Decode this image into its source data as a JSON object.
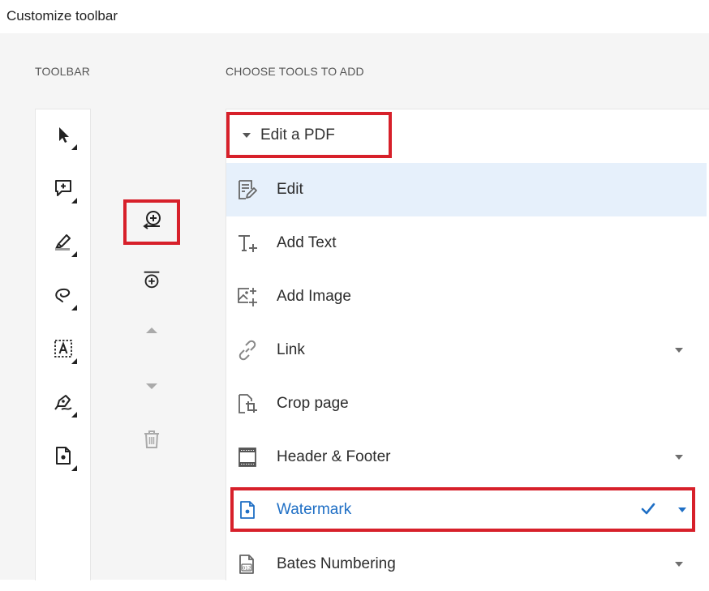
{
  "window": {
    "title": "Customize toolbar"
  },
  "toolbar": {
    "label": "TOOLBAR",
    "items": [
      {
        "name": "select-icon"
      },
      {
        "name": "comment-icon"
      },
      {
        "name": "highlight-icon"
      },
      {
        "name": "lasso-icon"
      },
      {
        "name": "text-field-icon"
      },
      {
        "name": "sign-icon"
      },
      {
        "name": "watermark-icon"
      }
    ]
  },
  "actions": [
    {
      "name": "add-to-toolbar-icon",
      "highlighted": true
    },
    {
      "name": "add-divider-icon"
    },
    {
      "name": "move-up-icon"
    },
    {
      "name": "move-down-icon"
    },
    {
      "name": "delete-icon"
    }
  ],
  "tools_panel": {
    "label": "CHOOSE TOOLS TO ADD",
    "group": {
      "label": "Edit a PDF",
      "expanded": true
    },
    "items": [
      {
        "label": "Edit",
        "icon": "edit-icon",
        "selected": true
      },
      {
        "label": "Add Text",
        "icon": "add-text-icon"
      },
      {
        "label": "Add Image",
        "icon": "add-image-icon"
      },
      {
        "label": "Link",
        "icon": "link-icon",
        "has_menu": true
      },
      {
        "label": "Crop page",
        "icon": "crop-icon"
      },
      {
        "label": "Header & Footer",
        "icon": "header-footer-icon",
        "has_menu": true
      },
      {
        "label": "Watermark",
        "icon": "watermark-icon",
        "has_menu": true,
        "checked": true,
        "highlighted": true
      },
      {
        "label": "Bates Numbering",
        "icon": "bates-numbering-icon",
        "has_menu": true
      }
    ]
  },
  "colors": {
    "accent": "#1f6fc5",
    "highlight": "#d7202a",
    "selected_bg": "#e6f0fb"
  }
}
